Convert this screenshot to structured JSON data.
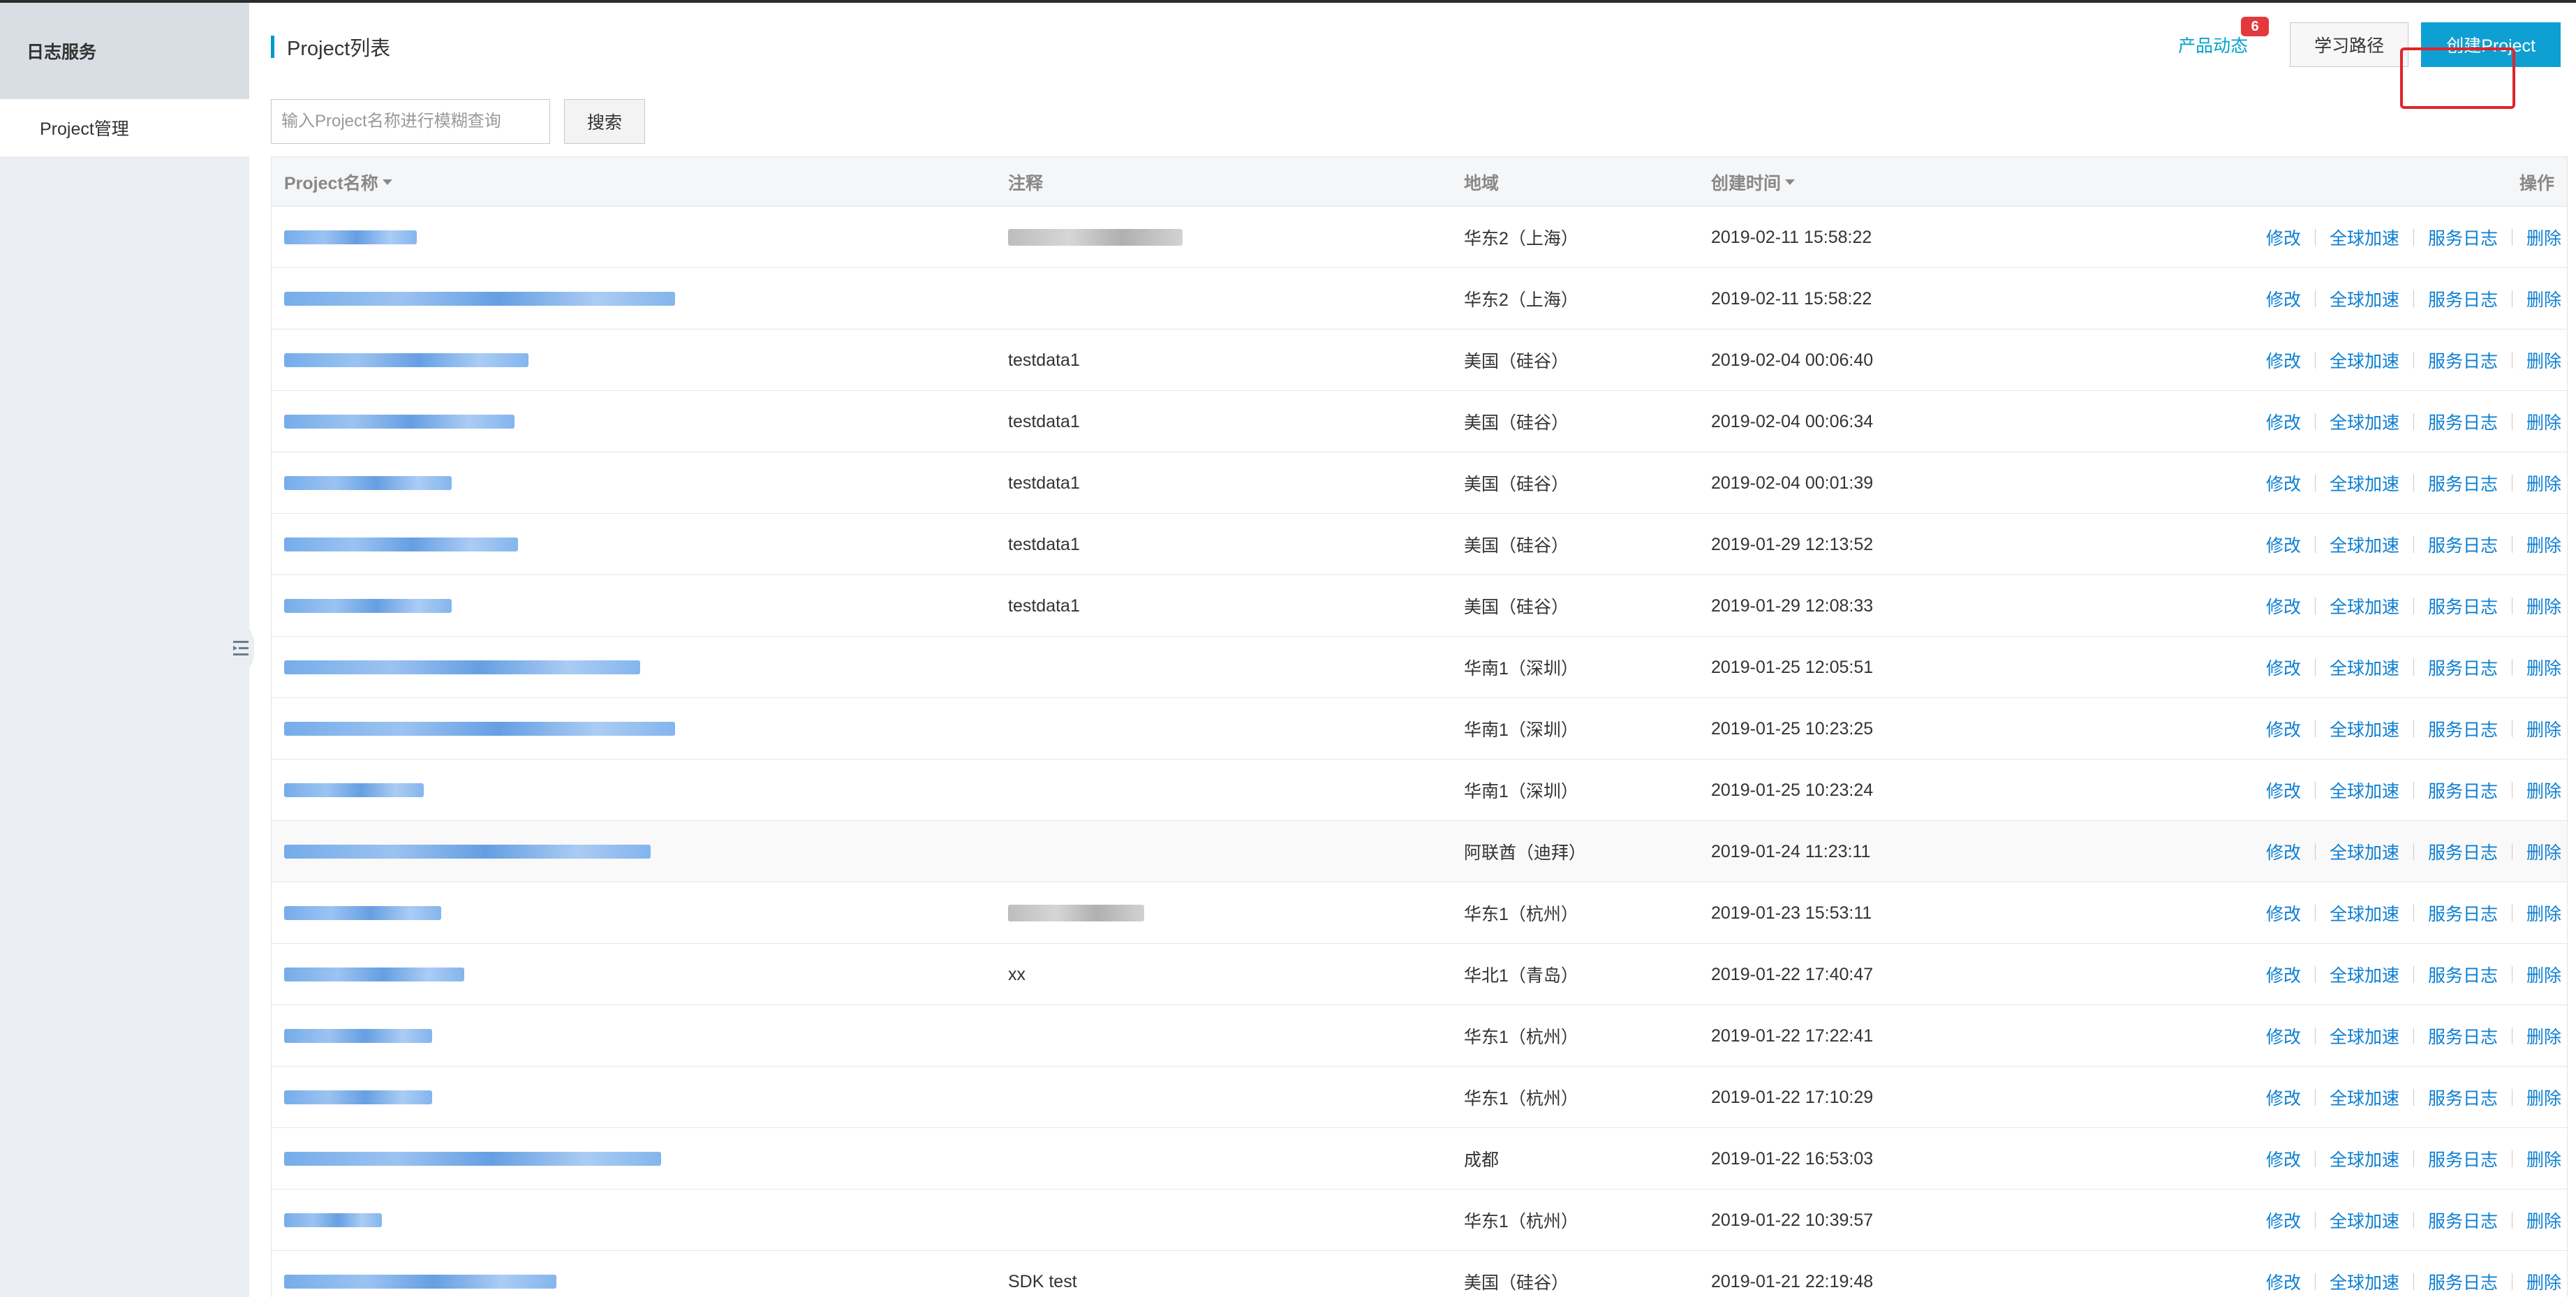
{
  "sidebar": {
    "title": "日志服务",
    "items": [
      {
        "label": "Project管理"
      }
    ]
  },
  "header": {
    "title": "Project列表",
    "news_label": "产品动态",
    "news_badge": "6",
    "learn_label": "学习路径",
    "create_label": "创建Project"
  },
  "search": {
    "placeholder": "输入Project名称进行模糊查询",
    "button_label": "搜索"
  },
  "table": {
    "columns": {
      "name": "Project名称",
      "note": "注释",
      "region": "地域",
      "created": "创建时间",
      "ops": "操作"
    },
    "op_labels": {
      "edit": "修改",
      "accel": "全球加速",
      "service_log": "服务日志",
      "delete": "删除"
    },
    "rows": [
      {
        "note": "",
        "region": "华东2（上海）",
        "created": "2019-02-11 15:58:22"
      },
      {
        "note": "",
        "region": "华东2（上海）",
        "created": "2019-02-11 15:58:22"
      },
      {
        "note": "testdata1",
        "region": "美国（硅谷）",
        "created": "2019-02-04 00:06:40"
      },
      {
        "note": "testdata1",
        "region": "美国（硅谷）",
        "created": "2019-02-04 00:06:34"
      },
      {
        "note": "testdata1",
        "region": "美国（硅谷）",
        "created": "2019-02-04 00:01:39"
      },
      {
        "note": "testdata1",
        "region": "美国（硅谷）",
        "created": "2019-01-29 12:13:52"
      },
      {
        "note": "testdata1",
        "region": "美国（硅谷）",
        "created": "2019-01-29 12:08:33"
      },
      {
        "note": "",
        "region": "华南1（深圳）",
        "created": "2019-01-25 12:05:51"
      },
      {
        "note": "",
        "region": "华南1（深圳）",
        "created": "2019-01-25 10:23:25"
      },
      {
        "note": "",
        "region": "华南1（深圳）",
        "created": "2019-01-25 10:23:24"
      },
      {
        "note": "",
        "region": "阿联酋（迪拜）",
        "created": "2019-01-24 11:23:11"
      },
      {
        "note": "",
        "region": "华东1（杭州）",
        "created": "2019-01-23 15:53:11"
      },
      {
        "note": "xx",
        "region": "华北1（青岛）",
        "created": "2019-01-22 17:40:47"
      },
      {
        "note": "",
        "region": "华东1（杭州）",
        "created": "2019-01-22 17:22:41"
      },
      {
        "note": "",
        "region": "华东1（杭州）",
        "created": "2019-01-22 17:10:29"
      },
      {
        "note": "",
        "region": "成都",
        "created": "2019-01-22 16:53:03"
      },
      {
        "note": "",
        "region": "华东1（杭州）",
        "created": "2019-01-22 10:39:57"
      },
      {
        "note": "SDK test",
        "region": "美国（硅谷）",
        "created": "2019-01-21 22:19:48"
      }
    ]
  },
  "colors": {
    "accent": "#0ea0d2",
    "link": "#0b7ed2",
    "badge": "#e4393c",
    "highlight": "#e0242c"
  }
}
